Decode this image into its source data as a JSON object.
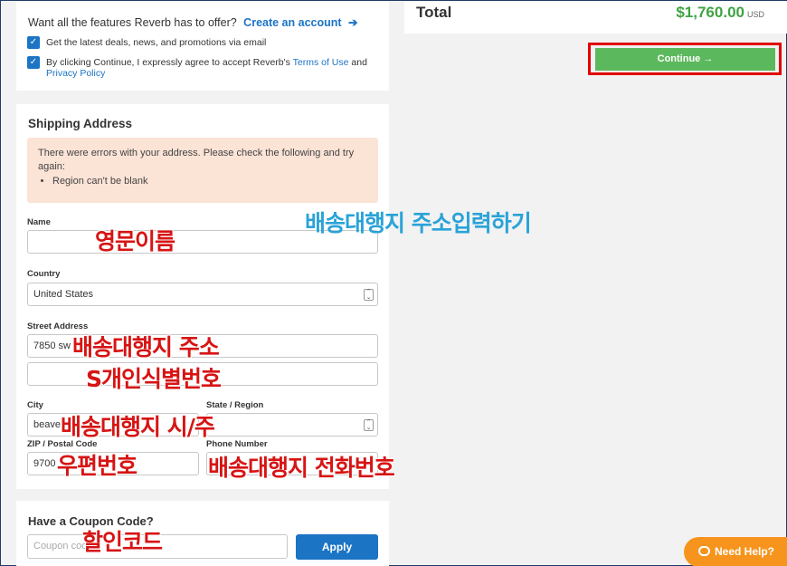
{
  "account": {
    "prompt": "Want all the features Reverb has to offer?",
    "create_link": "Create an account",
    "checkbox_deals": "Get the latest deals, news, and promotions via email",
    "checkbox_terms_prefix": "By clicking Continue, I expressly agree to accept Reverb's",
    "terms_link": "Terms of Use",
    "and": "and",
    "privacy_link": "Privacy Policy"
  },
  "shipping": {
    "title": "Shipping Address",
    "error_message": "There were errors with your address. Please check the following and try again:",
    "error_items": [
      "Region can't be blank"
    ],
    "name_label": "Name",
    "name_value": "",
    "country_label": "Country",
    "country_value": "United States",
    "street_label": "Street Address",
    "street_value": "7850 sw",
    "street2_value": "",
    "city_label": "City",
    "city_value": "beave",
    "state_label": "State / Region",
    "state_value": "",
    "zip_label": "ZIP / Postal Code",
    "zip_value": "9700",
    "phone_label": "Phone Number",
    "phone_value": ""
  },
  "coupon": {
    "title": "Have a Coupon Code?",
    "placeholder": "Coupon code",
    "apply_label": "Apply"
  },
  "summary": {
    "total_label": "Total",
    "total_value": "$1,760.00",
    "currency": "USD",
    "continue_label": "Continue →"
  },
  "annotations": {
    "name": "영문이름",
    "header": "배송대행지 주소입력하기",
    "street": "배송대행지 주소",
    "id_code": "S개인식별번호",
    "city_state": "배송대행지 시/주",
    "zip": "우편번호",
    "phone": "배송대행지 전화번호",
    "coupon": "할인코드"
  },
  "help": {
    "label": "Need Help?"
  },
  "colors": {
    "accent_blue": "#1b74c4",
    "green": "#5cb85c",
    "price_green": "#3fa342",
    "error_bg": "#fbe3d6",
    "highlight_red": "#e10000",
    "help_orange": "#f7941d"
  }
}
